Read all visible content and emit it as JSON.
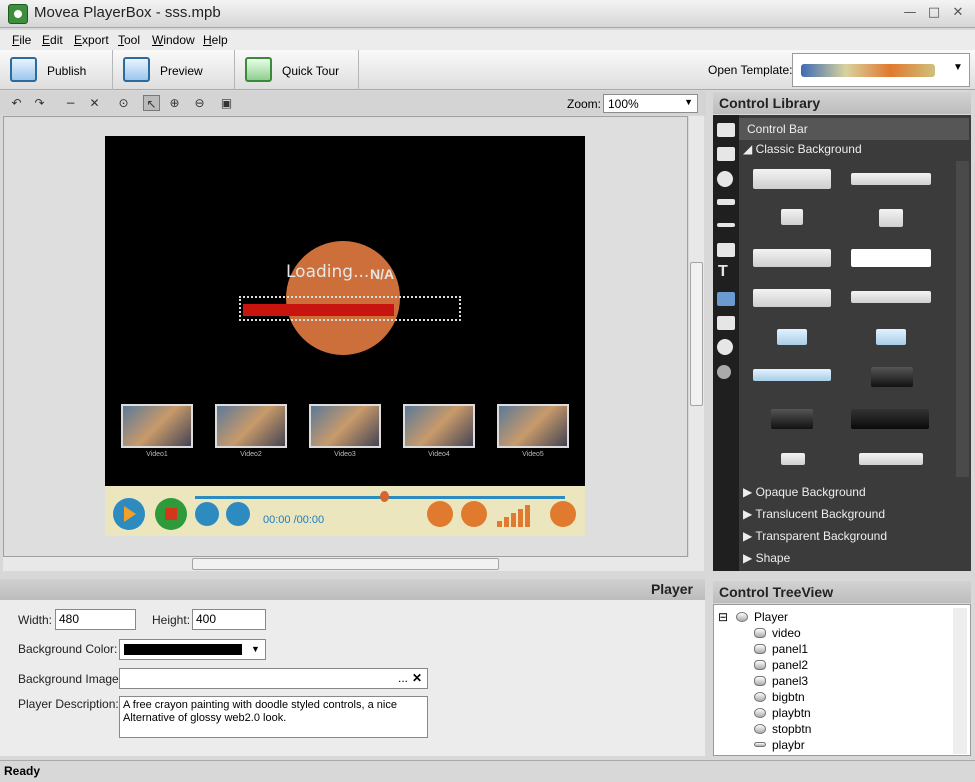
{
  "window": {
    "title": "Movea PlayerBox - sss.mpb"
  },
  "menu": {
    "items": [
      "File",
      "Edit",
      "Export",
      "Tool",
      "Window",
      "Help"
    ]
  },
  "toolbar": {
    "publish_label": "Publish",
    "preview_label": "Preview",
    "quicktour_label": "Quick Tour",
    "open_template_label": "Open Template:"
  },
  "canvas": {
    "zoom_label": "Zoom:",
    "zoom_value": "100%"
  },
  "player": {
    "loading_text": "Loading...",
    "loading_status": "N/A",
    "progress": 0.68,
    "thumbnails": [
      "Video1",
      "Video2",
      "Video3",
      "Video4",
      "Video5"
    ],
    "time_text": "00:00 /00:00",
    "seek_position": 0.5
  },
  "properties": {
    "title": "Player",
    "width_label": "Width:",
    "width_value": "480",
    "height_label": "Height:",
    "height_value": "400",
    "bgcolor_label": "Background Color:",
    "bgcolor_value": "#000000",
    "bgimage_label": "Background Image:",
    "bgimage_browse": "...",
    "bgimage_clear": "✕",
    "desc_label": "Player Description:",
    "desc_value": "A free crayon painting with doodle styled controls, a nice Alternative of glossy web2.0 look."
  },
  "library": {
    "title": "Control Library",
    "category": "Control Bar",
    "expanded_group": "Classic Background",
    "groups": [
      "Opaque Background",
      "Translucent Background",
      "Transparent Background",
      "Shape"
    ]
  },
  "tree": {
    "title": "Control TreeView",
    "root": "Player",
    "children": [
      "video",
      "panel1",
      "panel2",
      "panel3",
      "bigbtn",
      "playbtn",
      "stopbtn",
      "playbr"
    ]
  },
  "status": {
    "text": "Ready"
  },
  "colors": {
    "accent": "#2d8bbf",
    "progress": "#c8140f",
    "loading_circle": "#cc6f3a"
  }
}
